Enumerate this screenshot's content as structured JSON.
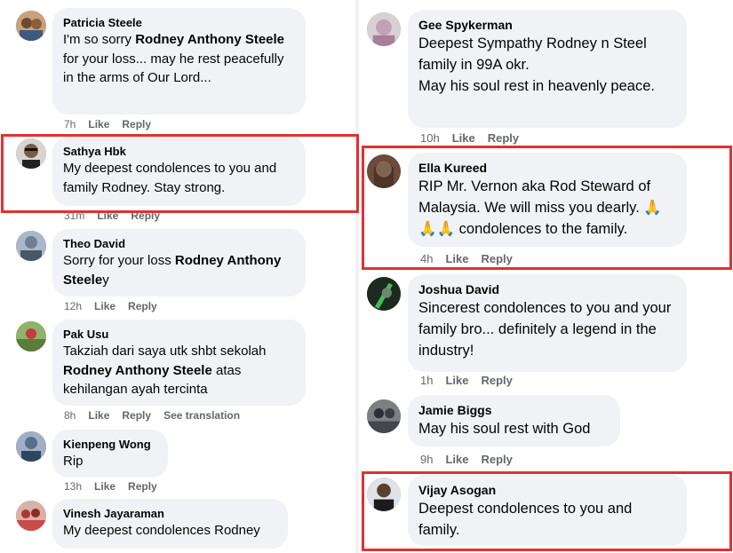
{
  "highlight_color": "#e03131",
  "left_comments": [
    {
      "author": "Patricia Steele",
      "text_parts": [
        "I'm so sorry ",
        "Rodney Anthony Steele",
        " for your loss... may he rest peacefully in the arms of Our Lord..."
      ],
      "time": "7h",
      "like": "Like",
      "reply": "Reply",
      "avatar_icon": "person-avatar-icon"
    },
    {
      "author": "Sathya Hbk",
      "text_parts": [
        "My deepest condolences to you and family Rodney. Stay strong.",
        "",
        ""
      ],
      "time": "31m",
      "like": "Like",
      "reply": "Reply",
      "avatar_icon": "person-avatar-icon"
    },
    {
      "author": "Theo David",
      "text_parts": [
        "Sorry for your loss ",
        "Rodney Anthony Steele",
        "y"
      ],
      "time": "12h",
      "like": "Like",
      "reply": "Reply",
      "avatar_icon": "person-avatar-icon"
    },
    {
      "author": "Pak Usu",
      "text_parts": [
        "Takziah dari saya utk shbt sekolah ",
        "Rodney Anthony Steele",
        " atas kehilangan ayah tercinta"
      ],
      "time": "8h",
      "like": "Like",
      "reply": "Reply",
      "translate": "See translation",
      "avatar_icon": "person-avatar-icon"
    },
    {
      "author": "Kienpeng Wong",
      "text_parts": [
        "Rip",
        "",
        ""
      ],
      "time": "13h",
      "like": "Like",
      "reply": "Reply",
      "avatar_icon": "person-avatar-icon"
    },
    {
      "author": "Vinesh Jayaraman",
      "text_parts": [
        "My deepest condolences Rodney",
        "",
        ""
      ],
      "avatar_icon": "person-avatar-icon"
    }
  ],
  "right_comments": [
    {
      "author": "Gee Spykerman",
      "text": "Deepest Sympathy Rodney n Steel family in 99A okr.\nMay his soul rest in heavenly peace.",
      "time": "10h",
      "like": "Like",
      "reply": "Reply",
      "avatar_icon": "person-avatar-icon"
    },
    {
      "author": "Ella Kureed",
      "text": "RIP Mr. Vernon aka Rod Steward of Malaysia. We will miss you dearly. 🙏🙏🙏 condolences to the family.",
      "time": "4h",
      "like": "Like",
      "reply": "Reply",
      "avatar_icon": "person-avatar-icon"
    },
    {
      "author": "Joshua David",
      "text": "Sincerest condolences to you and your family bro... definitely a legend in the industry!",
      "time": "1h",
      "like": "Like",
      "reply": "Reply",
      "avatar_icon": "person-avatar-icon"
    },
    {
      "author": "Jamie Biggs",
      "text": "May his soul rest with God",
      "time": "9h",
      "like": "Like",
      "reply": "Reply",
      "avatar_icon": "person-avatar-icon"
    },
    {
      "author": "Vijay Asogan",
      "text": "Deepest condolences to you and family.",
      "avatar_icon": "person-avatar-icon"
    }
  ]
}
